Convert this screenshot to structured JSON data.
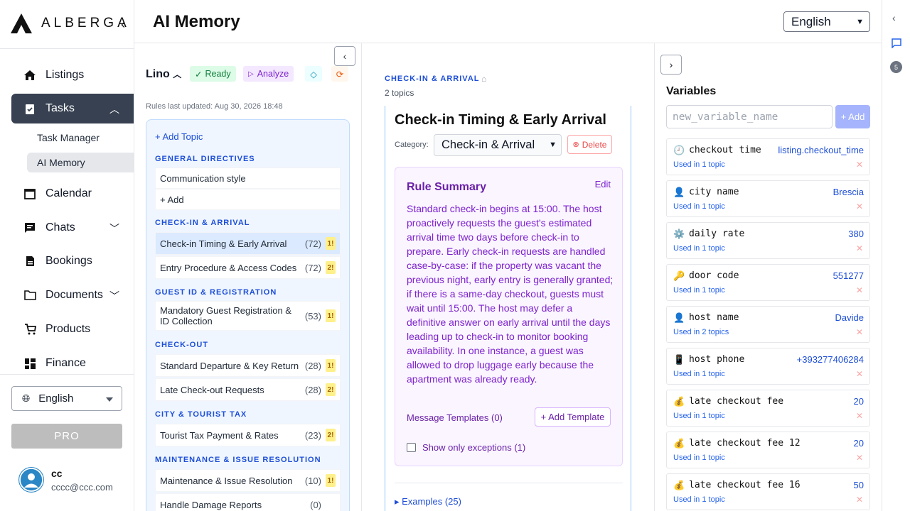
{
  "app": {
    "brand": "ALBERGA"
  },
  "sidebar": {
    "items": [
      {
        "label": "Listings",
        "icon": "home-icon"
      },
      {
        "label": "Tasks",
        "icon": "clipboard-icon"
      },
      {
        "label": "Calendar",
        "icon": "calendar-icon"
      },
      {
        "label": "Chats",
        "icon": "chat-icon"
      },
      {
        "label": "Bookings",
        "icon": "document-icon"
      },
      {
        "label": "Documents",
        "icon": "folder-icon"
      },
      {
        "label": "Products",
        "icon": "cart-icon"
      },
      {
        "label": "Finance",
        "icon": "grid-icon"
      }
    ],
    "sub_items": [
      {
        "label": "Task Manager"
      },
      {
        "label": "AI Memory"
      }
    ],
    "language": "English",
    "pro_label": "PRO",
    "user": {
      "name": "cc",
      "email": "cccc@ccc.com"
    }
  },
  "header": {
    "title": "AI Memory",
    "language": "English"
  },
  "topics_panel": {
    "listing_name": "Lino",
    "ready_label": "Ready",
    "analyze_label": "Analyze",
    "rules_updated": "Rules last updated: Aug 30, 2026 18:48",
    "add_topic": "+ Add Topic",
    "add_label": "+ Add",
    "categories": [
      {
        "name": "GENERAL DIRECTIVES",
        "topics": [
          {
            "name": "Communication style",
            "count": "",
            "flag": ""
          }
        ]
      },
      {
        "name": "CHECK-IN & ARRIVAL",
        "topics": [
          {
            "name": "Check-in Timing & Early Arrival",
            "count": "(72)",
            "flag": "1!"
          },
          {
            "name": "Entry Procedure & Access Codes",
            "count": "(72)",
            "flag": "2!"
          }
        ]
      },
      {
        "name": "GUEST ID & REGISTRATION",
        "topics": [
          {
            "name": "Mandatory Guest Registration & ID Collection",
            "count": "(53)",
            "flag": "1!"
          }
        ]
      },
      {
        "name": "CHECK-OUT",
        "topics": [
          {
            "name": "Standard Departure & Key Return",
            "count": "(28)",
            "flag": "1!"
          },
          {
            "name": "Late Check-out Requests",
            "count": "(28)",
            "flag": "2!"
          }
        ]
      },
      {
        "name": "CITY & TOURIST TAX",
        "topics": [
          {
            "name": "Tourist Tax Payment & Rates",
            "count": "(23)",
            "flag": "2!"
          }
        ]
      },
      {
        "name": "MAINTENANCE & ISSUE RESOLUTION",
        "topics": [
          {
            "name": "Maintenance & Issue Resolution",
            "count": "(10)",
            "flag": "1!"
          },
          {
            "name": "Handle Damage Reports",
            "count": "(0)",
            "flag": ""
          }
        ]
      }
    ]
  },
  "detail": {
    "category_heading": "CHECK-IN & ARRIVAL",
    "topic_count": "2 topics",
    "title": "Check-in Timing & Early Arrival",
    "category_label": "Category:",
    "category_value": "Check-in & Arrival",
    "delete_label": "Delete",
    "summary_title": "Rule Summary",
    "edit_label": "Edit",
    "summary_text": "Standard check-in begins at 15:00. The host proactively requests the guest's estimated arrival time two days before check-in to prepare. Early check-in requests are handled case-by-case: if the property was vacant the previous night, early entry is generally granted; if there is a same-day checkout, guests must wait until 15:00. The host may defer a definitive answer on early arrival until the days leading up to check-in to monitor booking availability. In one instance, a guest was allowed to drop luggage early because the apartment was already ready.",
    "templates_label": "Message Templates (0)",
    "add_template": "+ Add Template",
    "exceptions_label": "Show only exceptions (1)",
    "examples_label": "▸ Examples (25)"
  },
  "variables": {
    "title": "Variables",
    "placeholder": "new_variable_name",
    "add_label": "+ Add",
    "items": [
      {
        "emoji": "🕘",
        "name": "checkout time",
        "value": "listing.checkout_time",
        "used": "Used in 1 topic"
      },
      {
        "emoji": "👤",
        "name": "city name",
        "value": "Brescia",
        "used": "Used in 1 topic"
      },
      {
        "emoji": "⚙️",
        "name": "daily rate",
        "value": "380",
        "used": "Used in 1 topic"
      },
      {
        "emoji": "🔑",
        "name": "door code",
        "value": "551277",
        "used": "Used in 1 topic"
      },
      {
        "emoji": "👤",
        "name": "host name",
        "value": "Davide",
        "used": "Used in 2 topics"
      },
      {
        "emoji": "📱",
        "name": "host phone",
        "value": "+393277406284",
        "used": "Used in 1 topic"
      },
      {
        "emoji": "💰",
        "name": "late checkout fee",
        "value": "20",
        "used": "Used in 1 topic"
      },
      {
        "emoji": "💰",
        "name": "late checkout fee 12",
        "value": "20",
        "used": "Used in 1 topic"
      },
      {
        "emoji": "💰",
        "name": "late checkout fee 16",
        "value": "50",
        "used": "Used in 1 topic"
      }
    ]
  },
  "rail": {
    "count": "5"
  }
}
